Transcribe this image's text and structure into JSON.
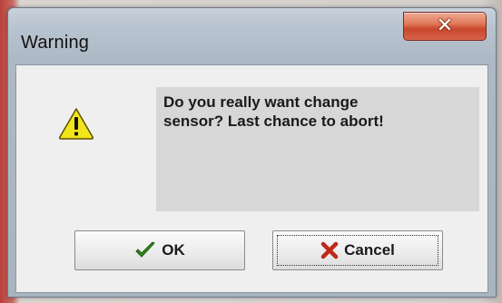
{
  "dialog": {
    "title": "Warning",
    "message": "Do you really want change\nsensor?  Last chance to abort!",
    "icon": "warning-icon"
  },
  "buttons": {
    "ok_label": "OK",
    "cancel_label": "Cancel"
  },
  "colors": {
    "close_button": "#d9634a",
    "ok_check": "#2f8a1e",
    "cancel_x": "#c0281b",
    "warning_yellow": "#f2e41c"
  }
}
